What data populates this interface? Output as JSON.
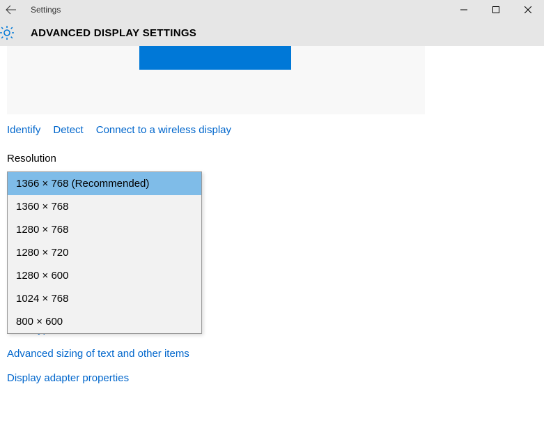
{
  "window": {
    "title": "Settings"
  },
  "header": {
    "title": "ADVANCED DISPLAY SETTINGS"
  },
  "links": {
    "identify": "Identify",
    "detect": "Detect",
    "connect": "Connect to a wireless display"
  },
  "resolution": {
    "label": "Resolution",
    "options": [
      "1366 × 768 (Recommended)",
      "1360 × 768",
      "1280 × 768",
      "1280 × 720",
      "1280 × 600",
      "1024 × 768",
      "800 × 600"
    ]
  },
  "related": {
    "cleartype": "ClearType text",
    "advanced_sizing": "Advanced sizing of text and other items",
    "adapter": "Display adapter properties"
  }
}
